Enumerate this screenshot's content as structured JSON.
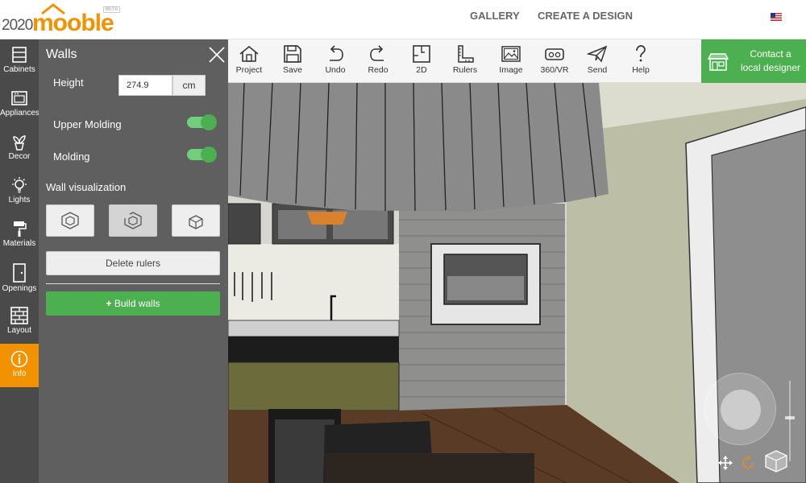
{
  "header": {
    "logo_prefix": "2020",
    "logo_name": "mooble",
    "logo_badge": "BETA",
    "nav": [
      {
        "label": "GALLERY"
      },
      {
        "label": "CREATE A DESIGN"
      }
    ],
    "language_flag_icon": "us-flag-icon"
  },
  "sidebar": {
    "items": [
      {
        "label": "Cabinets",
        "icon": "cabinet-icon"
      },
      {
        "label": "Appliances",
        "icon": "oven-icon"
      },
      {
        "label": "Decor",
        "icon": "plant-icon"
      },
      {
        "label": "Lights",
        "icon": "lightbulb-icon"
      },
      {
        "label": "Materials",
        "icon": "paint-roller-icon"
      },
      {
        "label": "Openings",
        "icon": "door-icon"
      },
      {
        "label": "Layout",
        "icon": "brick-wall-icon"
      },
      {
        "label": "Info",
        "icon": "info-icon",
        "active": true
      }
    ],
    "active_color": "#f39200"
  },
  "panel": {
    "title": "Walls",
    "height_label": "Height",
    "height_value": "274.9",
    "height_unit": "cm",
    "upper_molding_label": "Upper Molding",
    "upper_molding_on": true,
    "molding_label": "Molding",
    "molding_on": true,
    "wall_visualization_label": "Wall visualization",
    "visualization_modes": [
      "walls-full-icon",
      "walls-cut-icon",
      "walls-hidden-icon"
    ],
    "selected_visualization": 1,
    "delete_rulers_label": "Delete rulers",
    "build_walls_label": "Build walls",
    "build_walls_icon": "plus-icon"
  },
  "toolbar": {
    "tools": [
      {
        "label": "Project",
        "icon": "house-icon"
      },
      {
        "label": "Save",
        "icon": "floppy-icon"
      },
      {
        "label": "Undo",
        "icon": "undo-icon"
      },
      {
        "label": "Redo",
        "icon": "redo-icon"
      },
      {
        "label": "2D",
        "icon": "floorplan-icon"
      },
      {
        "label": "Rulers",
        "icon": "ruler-icon"
      },
      {
        "label": "Image",
        "icon": "image-icon"
      },
      {
        "label": "360/VR",
        "icon": "vr-headset-icon"
      },
      {
        "label": "Send",
        "icon": "paper-plane-icon"
      },
      {
        "label": "Help",
        "icon": "question-icon"
      }
    ],
    "contact_line1": "Contact a",
    "contact_line2": "local designer",
    "contact_icon": "storefront-icon",
    "accent": "#4caf50"
  },
  "viewport": {
    "controls": [
      "pan-icon",
      "rotate-icon",
      "view-cube-icon",
      "navigation-joystick",
      "zoom-slider"
    ]
  }
}
